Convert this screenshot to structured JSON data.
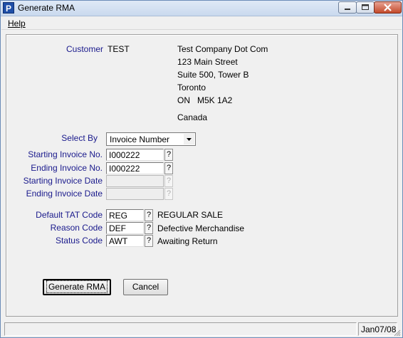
{
  "window": {
    "title": "Generate RMA",
    "app_icon_letter": "P"
  },
  "menu": {
    "help": "Help"
  },
  "customer": {
    "label": "Customer",
    "code": "TEST",
    "name": "Test Company Dot Com",
    "address1": "123 Main Street",
    "address2": "Suite 500, Tower B",
    "city": "Toronto",
    "province": "ON",
    "postal": "M5K 1A2",
    "country": "Canada"
  },
  "select_by": {
    "label": "Select By",
    "value": "Invoice Number"
  },
  "fields": {
    "starting_invoice_no": {
      "label": "Starting Invoice No.",
      "value": "I000222"
    },
    "ending_invoice_no": {
      "label": "Ending Invoice No.",
      "value": "I000222"
    },
    "starting_invoice_date": {
      "label": "Starting Invoice Date",
      "value": ""
    },
    "ending_invoice_date": {
      "label": "Ending Invoice Date",
      "value": ""
    },
    "default_tat_code": {
      "label": "Default TAT Code",
      "value": "REG",
      "description": "REGULAR SALE"
    },
    "reason_code": {
      "label": "Reason Code",
      "value": "DEF",
      "description": "Defective Merchandise"
    },
    "status_code": {
      "label": "Status Code",
      "value": "AWT",
      "description": "Awaiting Return"
    }
  },
  "lookup_label": "?",
  "buttons": {
    "generate": "Generate RMA",
    "cancel": "Cancel"
  },
  "status": {
    "date": "Jan07/08"
  }
}
